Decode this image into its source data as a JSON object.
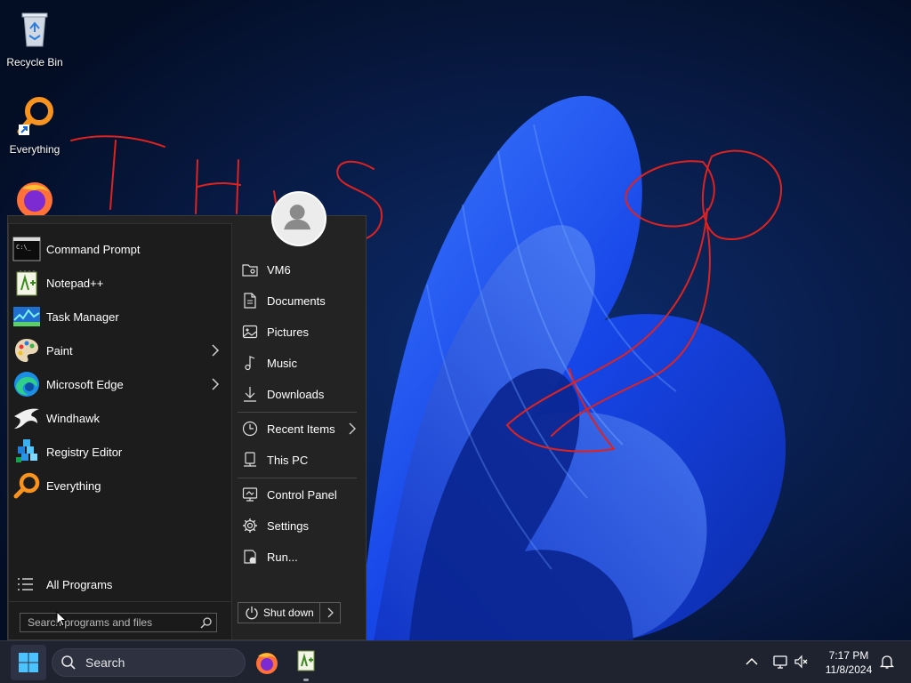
{
  "desktop": {
    "icons": [
      {
        "label": "Recycle Bin",
        "icon": "recycle-bin-icon"
      },
      {
        "label": "Everything",
        "icon": "everything-search-icon"
      },
      {
        "label": "",
        "icon": "firefox-icon"
      }
    ]
  },
  "start_menu": {
    "programs": [
      {
        "label": "Command Prompt",
        "icon": "command-prompt-icon",
        "has_submenu": false
      },
      {
        "label": "Notepad++",
        "icon": "notepad-plus-plus-icon",
        "has_submenu": false
      },
      {
        "label": "Task Manager",
        "icon": "task-manager-icon",
        "has_submenu": false
      },
      {
        "label": "Paint",
        "icon": "paint-icon",
        "has_submenu": true
      },
      {
        "label": "Microsoft Edge",
        "icon": "edge-icon",
        "has_submenu": true
      },
      {
        "label": "Windhawk",
        "icon": "windhawk-icon",
        "has_submenu": false
      },
      {
        "label": "Registry Editor",
        "icon": "registry-editor-icon",
        "has_submenu": false
      },
      {
        "label": "Everything",
        "icon": "everything-search-icon",
        "has_submenu": false
      }
    ],
    "all_programs_label": "All Programs",
    "search_placeholder": "Search programs and files",
    "places": [
      {
        "label": "VM6",
        "icon": "user-folder-icon"
      },
      {
        "label": "Documents",
        "icon": "documents-icon"
      },
      {
        "label": "Pictures",
        "icon": "pictures-icon"
      },
      {
        "label": "Music",
        "icon": "music-icon"
      },
      {
        "label": "Downloads",
        "icon": "downloads-icon"
      },
      {
        "label": "Recent Items",
        "icon": "clock-icon",
        "has_submenu": true
      },
      {
        "label": "This PC",
        "icon": "this-pc-icon"
      },
      {
        "label": "Control Panel",
        "icon": "control-panel-icon"
      },
      {
        "label": "Settings",
        "icon": "gear-icon"
      },
      {
        "label": "Run...",
        "icon": "run-icon"
      }
    ],
    "shutdown_label": "Shut down"
  },
  "taskbar": {
    "search_label": "Search",
    "apps": [
      {
        "name": "Firefox",
        "icon": "firefox-icon"
      },
      {
        "name": "Notepad++",
        "icon": "notepad-plus-plus-icon",
        "running": true
      }
    ],
    "tray": {
      "time": "7:17 PM",
      "date": "11/8/2024"
    }
  },
  "colors": {
    "menu_background": "#232323",
    "taskbar_background": "#1f2330",
    "annotation_red": "#e0221f",
    "wallpaper_blue": "#1a4cf0"
  }
}
